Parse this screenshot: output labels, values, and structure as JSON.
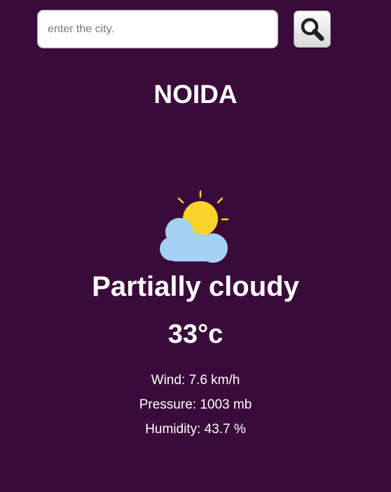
{
  "search": {
    "placeholder": "enter the city.",
    "value": "",
    "button_icon": "search-icon"
  },
  "weather": {
    "city": "NOIDA",
    "icon": "partly-cloudy-icon",
    "condition": "Partially cloudy",
    "temperature": "33°c",
    "wind": "Wind: 7.6 km/h",
    "pressure": "Pressure: 1003 mb",
    "humidity": "Humidity: 43.7 %"
  },
  "colors": {
    "background": "#3a0b3a",
    "text": "#ffffff",
    "sun": "#fcd22c",
    "cloud": "#a3d2f4"
  }
}
